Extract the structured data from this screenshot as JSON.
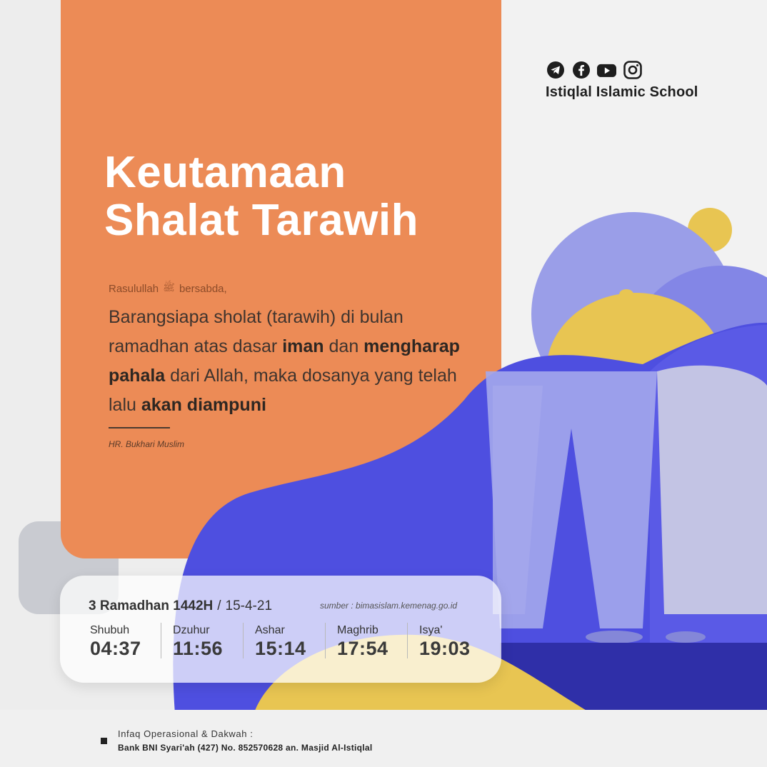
{
  "brand": {
    "name": "Istiqlal Islamic School",
    "social_icons": [
      "telegram-icon",
      "facebook-icon",
      "youtube-icon",
      "instagram-icon"
    ]
  },
  "headline": {
    "line1": "Keutamaan",
    "line2": "Shalat Tarawih"
  },
  "hadith": {
    "intro_before": "Rasulullah",
    "honorific_glyph": "ﷺ",
    "intro_after": "bersabda,",
    "quote_parts": [
      {
        "text": "Barangsiapa sholat (tarawih) di bulan ramadhan atas dasar ",
        "bold": false
      },
      {
        "text": "iman",
        "bold": true
      },
      {
        "text": " dan ",
        "bold": false
      },
      {
        "text": "mengharap pahala",
        "bold": true
      },
      {
        "text": " dari Allah, maka dosanya yang telah lalu ",
        "bold": false
      },
      {
        "text": "akan diampuni",
        "bold": true
      }
    ],
    "source": "HR. Bukhari Muslim"
  },
  "schedule": {
    "hijri_date": "3 Ramadhan 1442H",
    "separator": "/",
    "gregorian_date": "15-4-21",
    "source_note": "sumber : bimasislam.kemenag.go.id",
    "prayers": [
      {
        "name": "Shubuh",
        "time": "04:37"
      },
      {
        "name": "Dzuhur",
        "time": "11:56"
      },
      {
        "name": "Ashar",
        "time": "15:14"
      },
      {
        "name": "Maghrib",
        "time": "17:54"
      },
      {
        "name": "Isya'",
        "time": "19:03"
      }
    ]
  },
  "footer": {
    "line1": "Infaq Operasional & Dakwah :",
    "line2": "Bank BNI Syari'ah (427) No. 852570628 an. Masjid Al-Istiqlal"
  },
  "colors": {
    "orange": "#ec8b56",
    "blue": "#4e4fe0",
    "lavender": "#9a9ee8",
    "yellow": "#e8c552"
  }
}
